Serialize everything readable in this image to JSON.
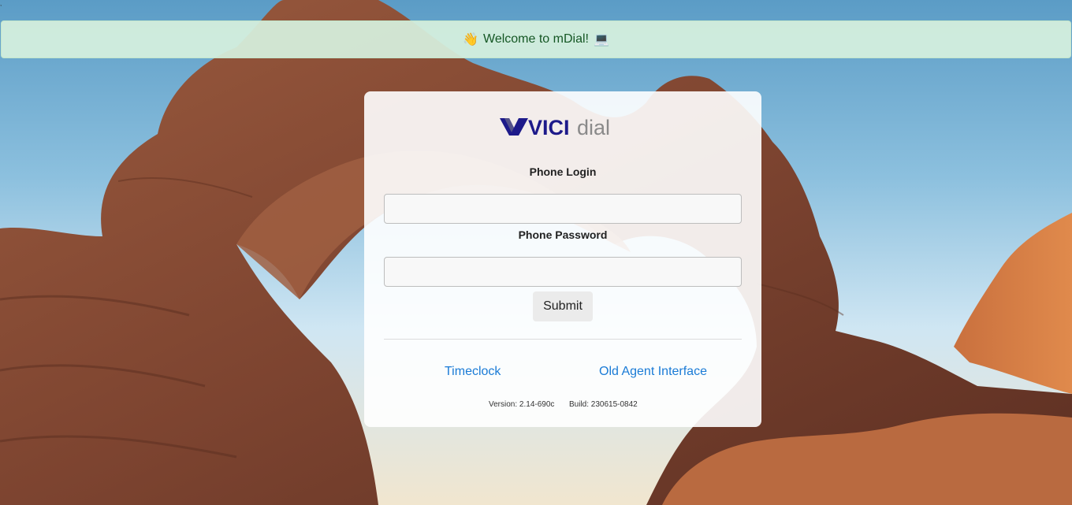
{
  "alert": {
    "wave_emoji": "👋",
    "text": "Welcome to mDial!",
    "computer_emoji": "💻"
  },
  "logo": {
    "bold": "VICI",
    "light": "dial"
  },
  "form": {
    "phone_login_label": "Phone Login",
    "phone_login_value": "",
    "phone_password_label": "Phone Password",
    "phone_password_value": "",
    "submit_label": "Submit"
  },
  "links": {
    "timeclock": "Timeclock",
    "old_agent_interface": "Old Agent Interface"
  },
  "footer": {
    "version": "Version: 2.14-690c",
    "build": "Build: 230615-0842"
  },
  "colors": {
    "alert_bg": "#d4edda",
    "alert_text": "#155724",
    "link": "#1a7bd6",
    "logo_blue": "#1d1a8a",
    "logo_gray": "#8a8a8a"
  }
}
